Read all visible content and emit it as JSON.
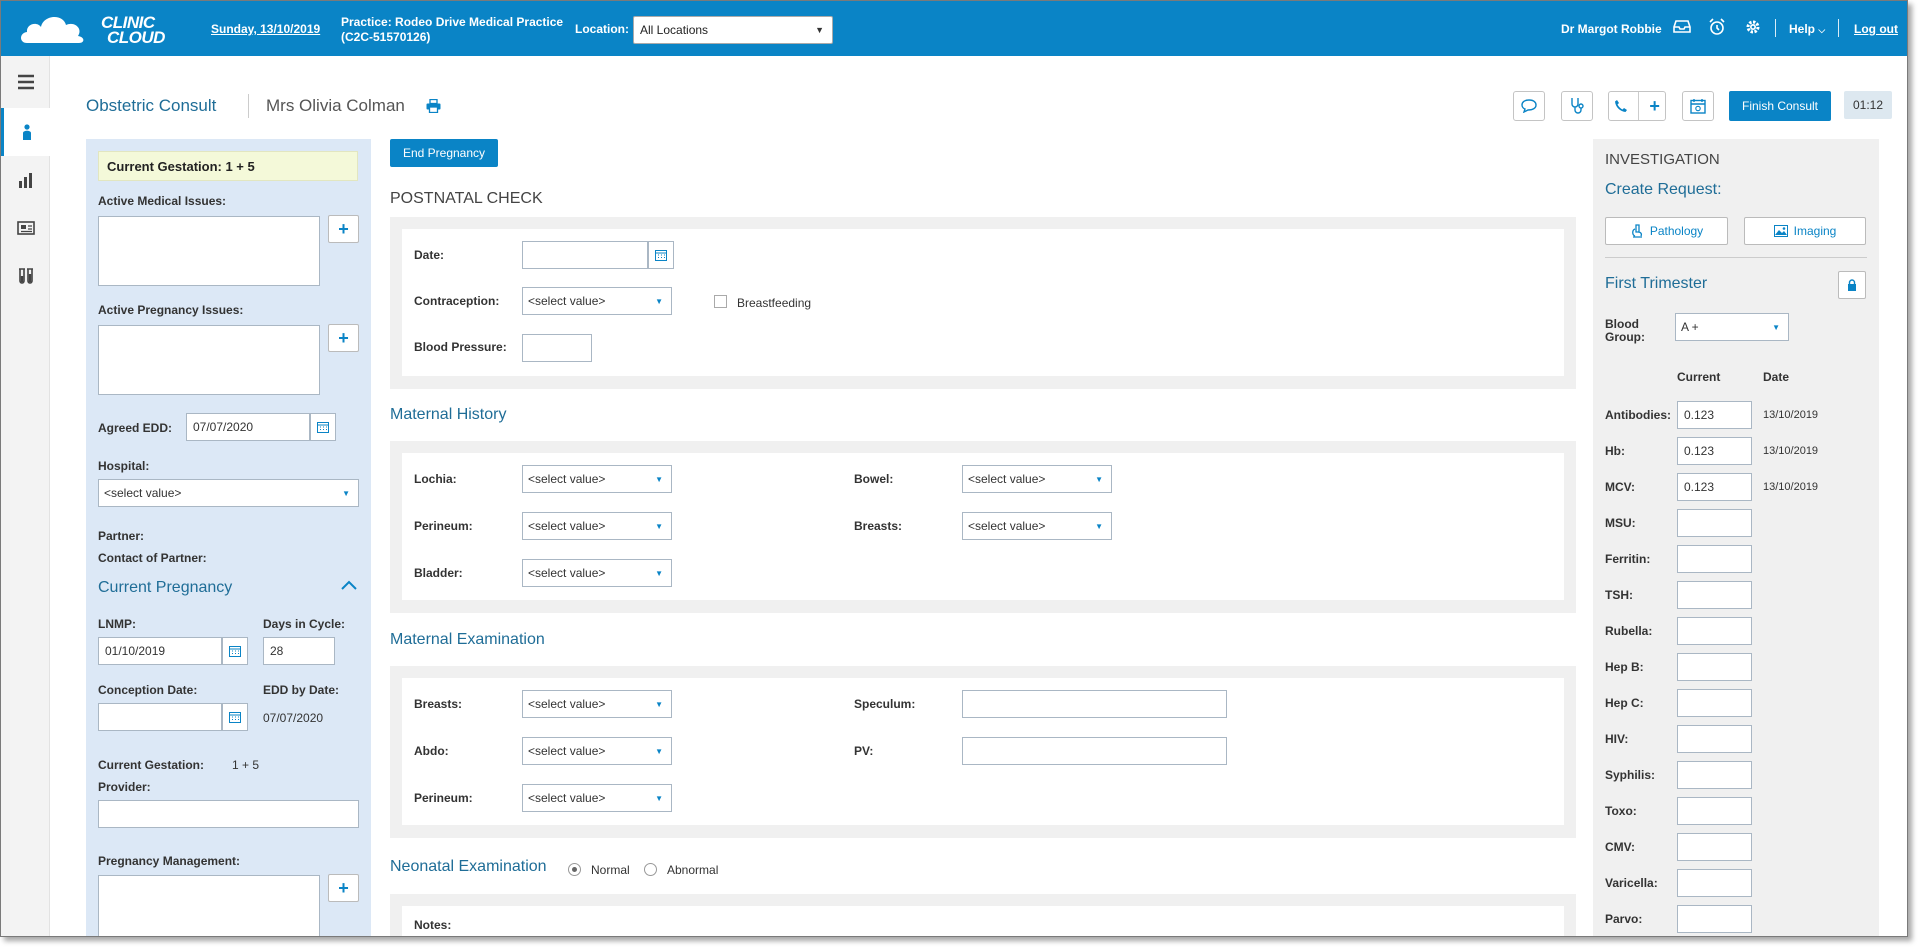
{
  "colors": {
    "brand": "#0a84c6",
    "panel": "#dce8f6",
    "gestation_highlight": "#f4f9d9"
  },
  "topbar": {
    "logo_line1": "CLINIC",
    "logo_line2": "CLOUD",
    "date": "Sunday, 13/10/2019",
    "practice_line1": "Practice: Rodeo Drive Medical Practice",
    "practice_line2": "(C2C-51570126)",
    "location_label": "Location:",
    "location_value": "All Locations",
    "user": "Dr Margot Robbie",
    "icons": [
      "inbox-icon",
      "alarm-clock-icon",
      "gear-icon"
    ],
    "help": "Help",
    "logout": "Log out"
  },
  "rail": {
    "items": [
      "menu-icon",
      "patient-icon",
      "chart-icon",
      "news-icon",
      "lab-icon"
    ]
  },
  "header": {
    "title": "Obstetric Consult",
    "patient": "Mrs Olivia Colman",
    "finish": "Finish Consult",
    "timer": "01:12"
  },
  "left": {
    "current_gestation_banner": "Current Gestation: 1 + 5",
    "active_medical_issues": "Active Medical Issues:",
    "active_pregnancy_issues": "Active Pregnancy Issues:",
    "agreed_edd_label": "Agreed EDD:",
    "agreed_edd_value": "07/07/2020",
    "hospital_label": "Hospital:",
    "hospital_value": "<select value>",
    "partner_label": "Partner:",
    "contact_label": "Contact of Partner:",
    "current_pregnancy": "Current Pregnancy",
    "lnmp_label": "LNMP:",
    "lnmp_value": "01/10/2019",
    "days_label": "Days in Cycle:",
    "days_value": "28",
    "conception_label": "Conception Date:",
    "edd_by_date_label": "EDD by Date:",
    "edd_by_date_value": "07/07/2020",
    "current_gestation_label": "Current Gestation:",
    "current_gestation_value": "1 + 5",
    "provider_label": "Provider:",
    "pregnancy_mgmt_label": "Pregnancy Management:"
  },
  "center": {
    "end_pregnancy": "End Pregnancy",
    "postnatal_title": "POSTNATAL CHECK",
    "date_label": "Date:",
    "contraception_label": "Contraception:",
    "select_placeholder": "<select value>",
    "breastfeeding": "Breastfeeding",
    "bp_label": "Blood Pressure:",
    "maternal_history_title": "Maternal History",
    "lochia": "Lochia:",
    "bowel": "Bowel:",
    "perineum": "Perineum:",
    "breasts": "Breasts:",
    "bladder": "Bladder:",
    "maternal_exam_title": "Maternal Examination",
    "abdo": "Abdo:",
    "speculum": "Speculum:",
    "pv": "PV:",
    "neonatal_title": "Neonatal Examination",
    "normal": "Normal",
    "abnormal": "Abnormal",
    "notes": "Notes:"
  },
  "right": {
    "investigation": "INVESTIGATION",
    "create_request": "Create Request:",
    "pathology": "Pathology",
    "imaging": "Imaging",
    "first_trimester": "First Trimester",
    "blood_group_label": "Blood Group:",
    "blood_group_value": "A +",
    "col_current": "Current",
    "col_date": "Date",
    "tests": [
      {
        "label": "Antibodies:",
        "value": "0.123",
        "date": "13/10/2019"
      },
      {
        "label": "Hb:",
        "value": "0.123",
        "date": "13/10/2019"
      },
      {
        "label": "MCV:",
        "value": "0.123",
        "date": "13/10/2019"
      },
      {
        "label": "MSU:",
        "value": "",
        "date": ""
      },
      {
        "label": "Ferritin:",
        "value": "",
        "date": ""
      },
      {
        "label": "TSH:",
        "value": "",
        "date": ""
      },
      {
        "label": "Rubella:",
        "value": "",
        "date": ""
      },
      {
        "label": "Hep B:",
        "value": "",
        "date": ""
      },
      {
        "label": "Hep C:",
        "value": "",
        "date": ""
      },
      {
        "label": "HIV:",
        "value": "",
        "date": ""
      },
      {
        "label": "Syphilis:",
        "value": "",
        "date": ""
      },
      {
        "label": "Toxo:",
        "value": "",
        "date": ""
      },
      {
        "label": "CMV:",
        "value": "",
        "date": ""
      },
      {
        "label": "Varicella:",
        "value": "",
        "date": ""
      },
      {
        "label": "Parvo:",
        "value": "",
        "date": ""
      }
    ]
  }
}
